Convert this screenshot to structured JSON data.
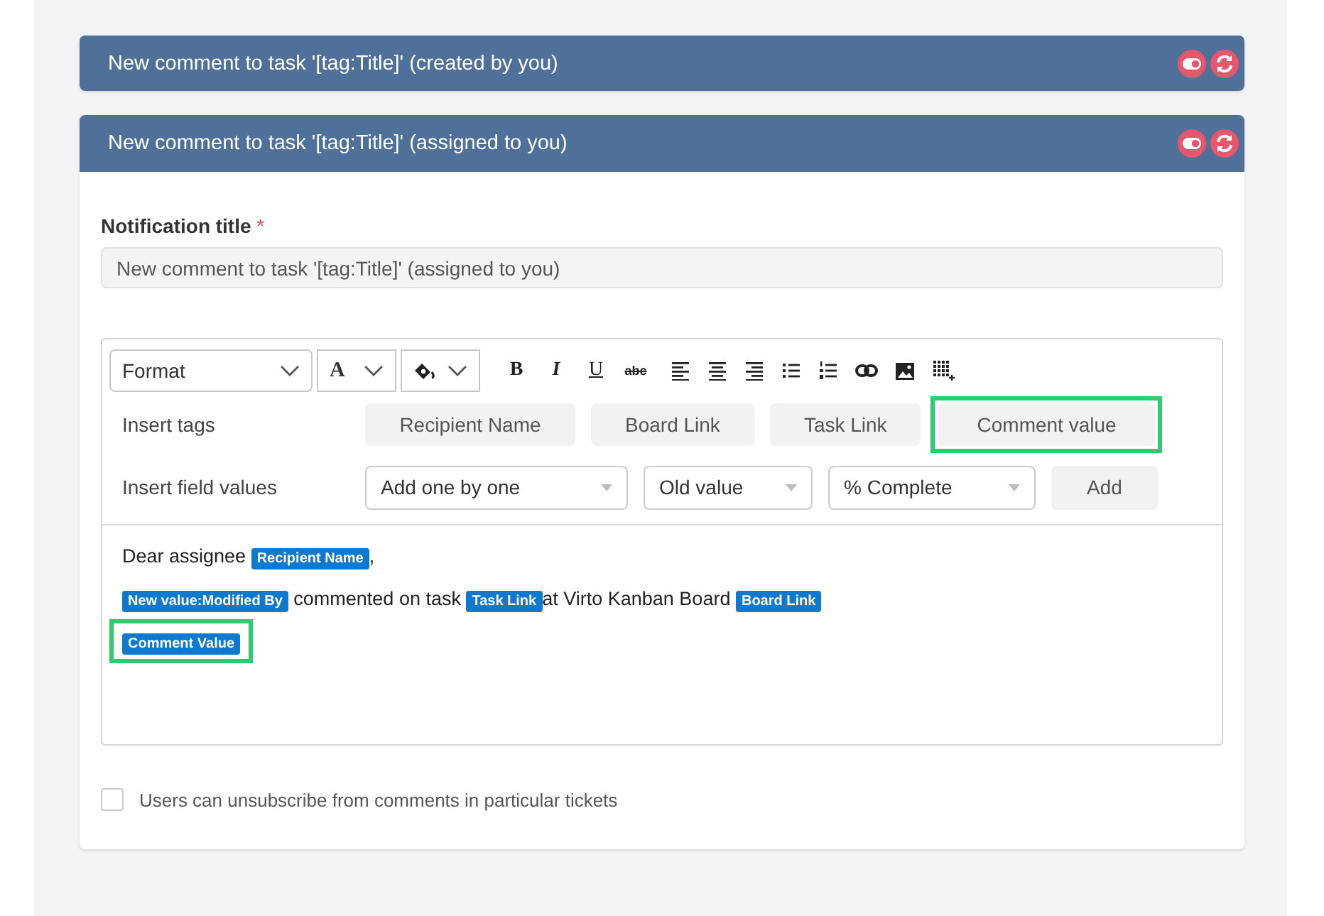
{
  "cards": [
    {
      "title": "New comment to task '[tag:Title]' (created by you)",
      "expanded": false
    },
    {
      "title": "New comment to task '[tag:Title]' (assigned to you)",
      "expanded": true
    }
  ],
  "form": {
    "title_label": "Notification title",
    "required_mark": "*",
    "title_value": "New comment to task '[tag:Title]' (assigned to you)",
    "toolbar": {
      "format": "Format",
      "font_color": "A",
      "text_buttons": [
        "B",
        "I",
        "U",
        "abc"
      ]
    },
    "insert_tags_label": "Insert tags",
    "tags": [
      {
        "label": "Recipient Name",
        "highlighted": false
      },
      {
        "label": "Board Link",
        "highlighted": false
      },
      {
        "label": "Task Link",
        "highlighted": false
      },
      {
        "label": "Comment value",
        "highlighted": true
      }
    ],
    "insert_fields_label": "Insert field values",
    "field_selects": [
      "Add one by one",
      "Old value",
      "% Complete"
    ],
    "add_button": "Add",
    "content": [
      [
        {
          "kind": "text",
          "text": "Dear assignee "
        },
        {
          "kind": "chip",
          "text": "Recipient Name",
          "highlighted": false
        },
        {
          "kind": "text",
          "text": ","
        }
      ],
      [
        {
          "kind": "chip",
          "text": "New value:Modified By",
          "highlighted": false
        },
        {
          "kind": "text",
          "text": " commented on task "
        },
        {
          "kind": "chip",
          "text": "Task Link",
          "highlighted": false
        },
        {
          "kind": "text",
          "text": "at Virto Kanban Board "
        },
        {
          "kind": "chip",
          "text": "Board Link",
          "highlighted": false
        }
      ],
      [
        {
          "kind": "chip",
          "text": "Comment Value",
          "highlighted": true
        }
      ]
    ],
    "unsubscribe": {
      "label": "Users can unsubscribe from comments in particular tickets",
      "checked": false
    }
  }
}
